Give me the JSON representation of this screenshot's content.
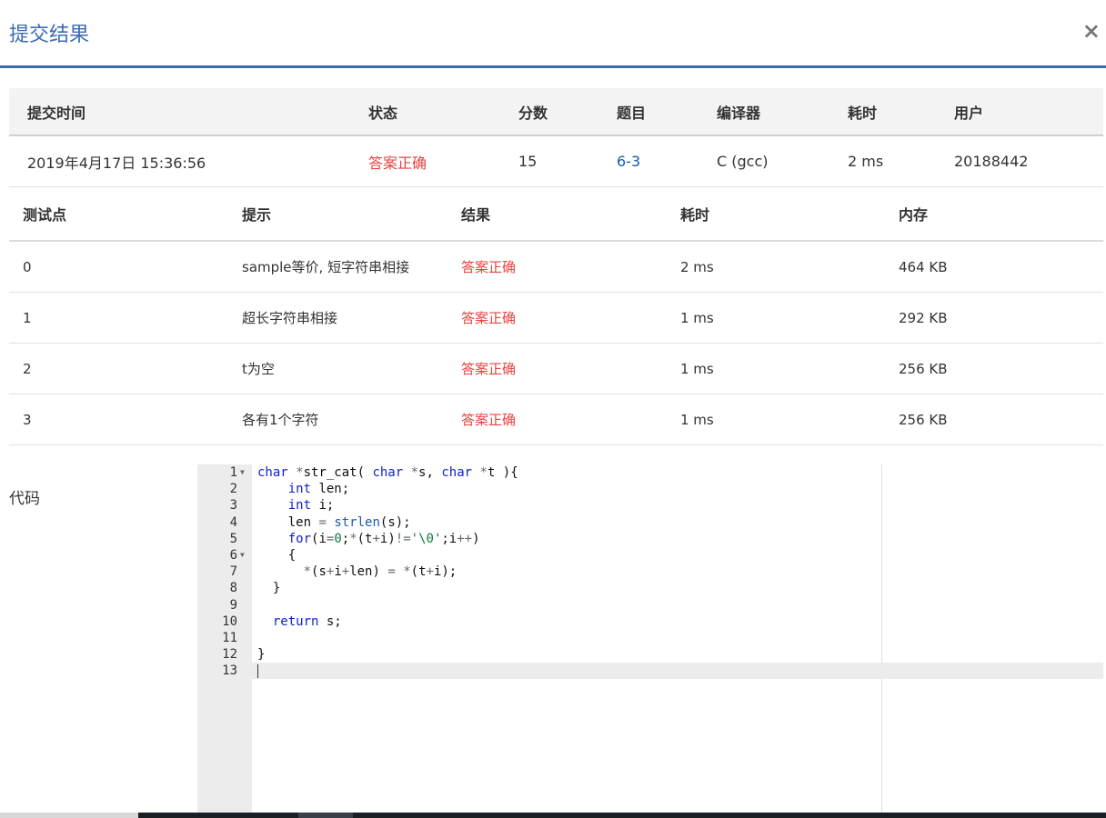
{
  "dialog": {
    "title": "提交结果",
    "close_symbol": "×"
  },
  "submission": {
    "headers": [
      "提交时间",
      "状态",
      "分数",
      "题目",
      "编译器",
      "耗时",
      "用户"
    ],
    "row": {
      "time": "2019年4月17日 15:36:56",
      "status": "答案正确",
      "score": "15",
      "problem": "6-3",
      "compiler": "C (gcc)",
      "elapsed": "2 ms",
      "user": "20188442"
    }
  },
  "tests": {
    "headers": [
      "测试点",
      "提示",
      "结果",
      "耗时",
      "内存"
    ],
    "rows": [
      {
        "id": "0",
        "hint": "sample等价, 短字符串相接",
        "result": "答案正确",
        "time": "2 ms",
        "memory": "464 KB"
      },
      {
        "id": "1",
        "hint": "超长字符串相接",
        "result": "答案正确",
        "time": "1 ms",
        "memory": "292 KB"
      },
      {
        "id": "2",
        "hint": "t为空",
        "result": "答案正确",
        "time": "1 ms",
        "memory": "256 KB"
      },
      {
        "id": "3",
        "hint": "各有1个字符",
        "result": "答案正确",
        "time": "1 ms",
        "memory": "256 KB"
      }
    ]
  },
  "code": {
    "label": "代码",
    "line_numbers": [
      "1",
      "2",
      "3",
      "4",
      "5",
      "6",
      "7",
      "8",
      "9",
      "10",
      "11",
      "12",
      "13"
    ],
    "lines": [
      "char *str_cat( char *s, char *t ){",
      "    int len;",
      "    int i;",
      "    len = strlen(s);",
      "    for(i=0;*(t+i)!='\\0';i++)",
      "    {",
      "      *(s+i+len) = *(t+i);",
      "  }",
      "",
      "  return s;",
      "",
      "}",
      ""
    ],
    "fold_icon": "fold-triangle-icon"
  },
  "colors": {
    "accent": "#3d6bb3",
    "success": "#e64340",
    "link": "#1a5ba6"
  }
}
